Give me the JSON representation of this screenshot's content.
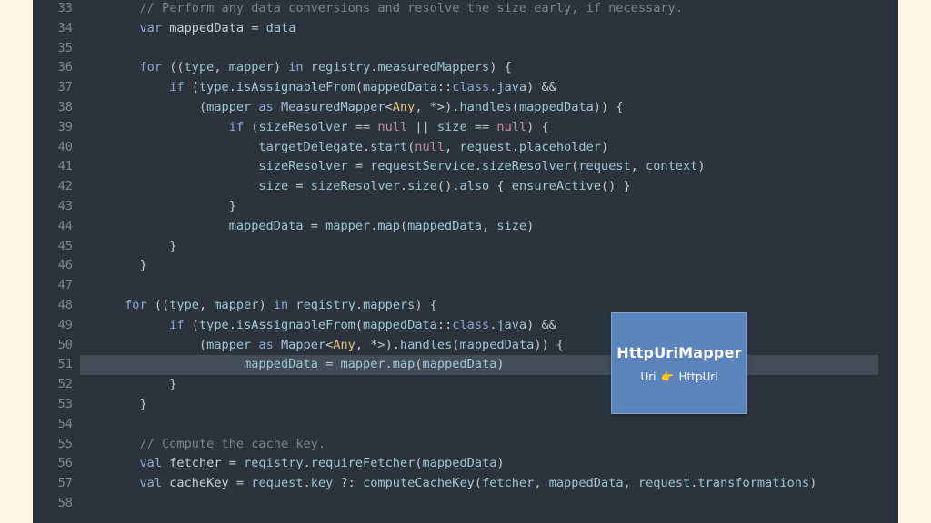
{
  "editor": {
    "lines": [
      {
        "n": "33",
        "tokens": [
          [
            "        ",
            "pun"
          ],
          [
            "// Perform any data conversions and resolve the size early, if necessary.",
            "cm"
          ]
        ]
      },
      {
        "n": "34",
        "tokens": [
          [
            "        ",
            "pun"
          ],
          [
            "var",
            "kw"
          ],
          [
            " mappedData ",
            "id"
          ],
          [
            "=",
            "pun"
          ],
          [
            " data",
            "prop"
          ]
        ]
      },
      {
        "n": "35",
        "tokens": []
      },
      {
        "n": "36",
        "tokens": [
          [
            "        ",
            "pun"
          ],
          [
            "for",
            "kw"
          ],
          [
            " ((",
            "pun"
          ],
          [
            "type",
            "prop"
          ],
          [
            ", ",
            "pun"
          ],
          [
            "mapper",
            "prop"
          ],
          [
            ") ",
            "pun"
          ],
          [
            "in",
            "kw"
          ],
          [
            " registry",
            "prop"
          ],
          [
            ".",
            "pun"
          ],
          [
            "measuredMappers",
            "prop"
          ],
          [
            ") {",
            "pun"
          ]
        ]
      },
      {
        "n": "37",
        "tokens": [
          [
            "            ",
            "pun"
          ],
          [
            "if",
            "kw"
          ],
          [
            " (",
            "pun"
          ],
          [
            "type",
            "prop"
          ],
          [
            ".",
            "pun"
          ],
          [
            "isAssignableFrom",
            "fn"
          ],
          [
            "(",
            "pun"
          ],
          [
            "mappedData",
            "prop"
          ],
          [
            "::",
            "pun"
          ],
          [
            "class",
            "kw"
          ],
          [
            ".",
            "pun"
          ],
          [
            "java",
            "prop"
          ],
          [
            ") ",
            "pun"
          ],
          [
            "&&",
            "pun"
          ]
        ]
      },
      {
        "n": "38",
        "tokens": [
          [
            "                ",
            "pun"
          ],
          [
            "(",
            "pun"
          ],
          [
            "mapper",
            "prop"
          ],
          [
            " as ",
            "kw"
          ],
          [
            "MeasuredMapper",
            "ty"
          ],
          [
            "<",
            "pun"
          ],
          [
            "Any",
            "any"
          ],
          [
            ", ",
            "pun"
          ],
          [
            "*>",
            "pun"
          ],
          [
            ").",
            "pun"
          ],
          [
            "handles",
            "fn"
          ],
          [
            "(",
            "pun"
          ],
          [
            "mappedData",
            "prop"
          ],
          [
            ")) {",
            "pun"
          ]
        ]
      },
      {
        "n": "39",
        "tokens": [
          [
            "                    ",
            "pun"
          ],
          [
            "if",
            "kw"
          ],
          [
            " (",
            "pun"
          ],
          [
            "sizeResolver",
            "prop"
          ],
          [
            " == ",
            "pun"
          ],
          [
            "null",
            "null"
          ],
          [
            " || ",
            "pun"
          ],
          [
            "size",
            "prop"
          ],
          [
            " == ",
            "pun"
          ],
          [
            "null",
            "null"
          ],
          [
            ") {",
            "pun"
          ]
        ]
      },
      {
        "n": "40",
        "tokens": [
          [
            "                        ",
            "pun"
          ],
          [
            "targetDelegate",
            "prop"
          ],
          [
            ".",
            "pun"
          ],
          [
            "start",
            "fn"
          ],
          [
            "(",
            "pun"
          ],
          [
            "null",
            "null"
          ],
          [
            ", ",
            "pun"
          ],
          [
            "request",
            "prop"
          ],
          [
            ".",
            "pun"
          ],
          [
            "placeholder",
            "prop"
          ],
          [
            ")",
            "pun"
          ]
        ]
      },
      {
        "n": "41",
        "tokens": [
          [
            "                        ",
            "pun"
          ],
          [
            "sizeResolver",
            "prop"
          ],
          [
            " = ",
            "pun"
          ],
          [
            "requestService",
            "prop"
          ],
          [
            ".",
            "pun"
          ],
          [
            "sizeResolver",
            "fn"
          ],
          [
            "(",
            "pun"
          ],
          [
            "request",
            "prop"
          ],
          [
            ", ",
            "pun"
          ],
          [
            "context",
            "prop"
          ],
          [
            ")",
            "pun"
          ]
        ]
      },
      {
        "n": "42",
        "tokens": [
          [
            "                        ",
            "pun"
          ],
          [
            "size",
            "prop"
          ],
          [
            " = ",
            "pun"
          ],
          [
            "sizeResolver",
            "prop"
          ],
          [
            ".",
            "pun"
          ],
          [
            "size",
            "fn"
          ],
          [
            "().",
            "pun"
          ],
          [
            "also",
            "fn"
          ],
          [
            " { ",
            "pun"
          ],
          [
            "ensureActive",
            "fn"
          ],
          [
            "() }",
            "pun"
          ]
        ]
      },
      {
        "n": "43",
        "tokens": [
          [
            "                    ",
            "pun"
          ],
          [
            "}",
            "pun"
          ]
        ]
      },
      {
        "n": "44",
        "tokens": [
          [
            "                    ",
            "pun"
          ],
          [
            "mappedData",
            "prop"
          ],
          [
            " = ",
            "pun"
          ],
          [
            "mapper",
            "prop"
          ],
          [
            ".",
            "pun"
          ],
          [
            "map",
            "fn"
          ],
          [
            "(",
            "pun"
          ],
          [
            "mappedData",
            "prop"
          ],
          [
            ", ",
            "pun"
          ],
          [
            "size",
            "prop"
          ],
          [
            ")",
            "pun"
          ]
        ]
      },
      {
        "n": "45",
        "tokens": [
          [
            "            ",
            "pun"
          ],
          [
            "}",
            "pun"
          ]
        ]
      },
      {
        "n": "46",
        "tokens": [
          [
            "        ",
            "pun"
          ],
          [
            "}",
            "pun"
          ]
        ]
      },
      {
        "n": "47",
        "tokens": []
      },
      {
        "n": "48",
        "tokens": [
          [
            "      ",
            "pun"
          ],
          [
            "for",
            "kw"
          ],
          [
            " ((",
            "pun"
          ],
          [
            "type",
            "prop"
          ],
          [
            ", ",
            "pun"
          ],
          [
            "mapper",
            "prop"
          ],
          [
            ") ",
            "pun"
          ],
          [
            "in",
            "kw"
          ],
          [
            " registry",
            "prop"
          ],
          [
            ".",
            "pun"
          ],
          [
            "mappers",
            "prop"
          ],
          [
            ") {",
            "pun"
          ]
        ]
      },
      {
        "n": "49",
        "tokens": [
          [
            "            ",
            "pun"
          ],
          [
            "if",
            "kw"
          ],
          [
            " (",
            "pun"
          ],
          [
            "type",
            "prop"
          ],
          [
            ".",
            "pun"
          ],
          [
            "isAssignableFrom",
            "fn"
          ],
          [
            "(",
            "pun"
          ],
          [
            "mappedData",
            "prop"
          ],
          [
            "::",
            "pun"
          ],
          [
            "class",
            "kw"
          ],
          [
            ".",
            "pun"
          ],
          [
            "java",
            "prop"
          ],
          [
            ") ",
            "pun"
          ],
          [
            "&&",
            "pun"
          ]
        ]
      },
      {
        "n": "50",
        "tokens": [
          [
            "                ",
            "pun"
          ],
          [
            "(",
            "pun"
          ],
          [
            "mapper",
            "prop"
          ],
          [
            " as ",
            "kw"
          ],
          [
            "Mapper",
            "ty"
          ],
          [
            "<",
            "pun"
          ],
          [
            "Any",
            "any"
          ],
          [
            ", ",
            "pun"
          ],
          [
            "*>",
            "pun"
          ],
          [
            ").",
            "pun"
          ],
          [
            "handles",
            "fn"
          ],
          [
            "(",
            "pun"
          ],
          [
            "mappedData",
            "prop"
          ],
          [
            ")) {",
            "pun"
          ]
        ]
      },
      {
        "n": "51",
        "hl": true,
        "tokens": [
          [
            "                      ",
            "pun"
          ],
          [
            "mappedData",
            "prop"
          ],
          [
            " = ",
            "pun"
          ],
          [
            "mapper",
            "prop"
          ],
          [
            ".",
            "pun"
          ],
          [
            "map",
            "fn"
          ],
          [
            "(",
            "pun"
          ],
          [
            "mappedData",
            "prop"
          ],
          [
            ")",
            "pun"
          ]
        ]
      },
      {
        "n": "52",
        "tokens": [
          [
            "            ",
            "pun"
          ],
          [
            "}",
            "pun"
          ]
        ]
      },
      {
        "n": "53",
        "tokens": [
          [
            "        ",
            "pun"
          ],
          [
            "}",
            "pun"
          ]
        ]
      },
      {
        "n": "54",
        "tokens": []
      },
      {
        "n": "55",
        "tokens": [
          [
            "        ",
            "pun"
          ],
          [
            "// Compute the cache key.",
            "cm"
          ]
        ]
      },
      {
        "n": "56",
        "tokens": [
          [
            "        ",
            "pun"
          ],
          [
            "val",
            "kw"
          ],
          [
            " fetcher ",
            "id"
          ],
          [
            "=",
            "pun"
          ],
          [
            " registry",
            "prop"
          ],
          [
            ".",
            "pun"
          ],
          [
            "requireFetcher",
            "fn"
          ],
          [
            "(",
            "pun"
          ],
          [
            "mappedData",
            "prop"
          ],
          [
            ")",
            "pun"
          ]
        ]
      },
      {
        "n": "57",
        "tokens": [
          [
            "        ",
            "pun"
          ],
          [
            "val",
            "kw"
          ],
          [
            " cacheKey ",
            "id"
          ],
          [
            "=",
            "pun"
          ],
          [
            " request",
            "prop"
          ],
          [
            ".",
            "pun"
          ],
          [
            "key",
            "prop"
          ],
          [
            " ?: ",
            "pun"
          ],
          [
            "computeCacheKey",
            "fn"
          ],
          [
            "(",
            "pun"
          ],
          [
            "fetcher",
            "prop"
          ],
          [
            ", ",
            "pun"
          ],
          [
            "mappedData",
            "prop"
          ],
          [
            ", ",
            "pun"
          ],
          [
            "request",
            "prop"
          ],
          [
            ".",
            "pun"
          ],
          [
            "transformations",
            "prop"
          ],
          [
            ")",
            "pun"
          ]
        ]
      },
      {
        "n": "58",
        "tokens": []
      }
    ]
  },
  "overlay": {
    "title": "HttpUriMapper",
    "from": "Uri",
    "pointer_icon": "pointing-hand-icon",
    "to": "HttpUrl"
  },
  "colors": {
    "background": "#fdf6e3",
    "editor_bg": "#2b333c",
    "highlight_line": "#424d57",
    "card_bg": "#5b84bd"
  }
}
